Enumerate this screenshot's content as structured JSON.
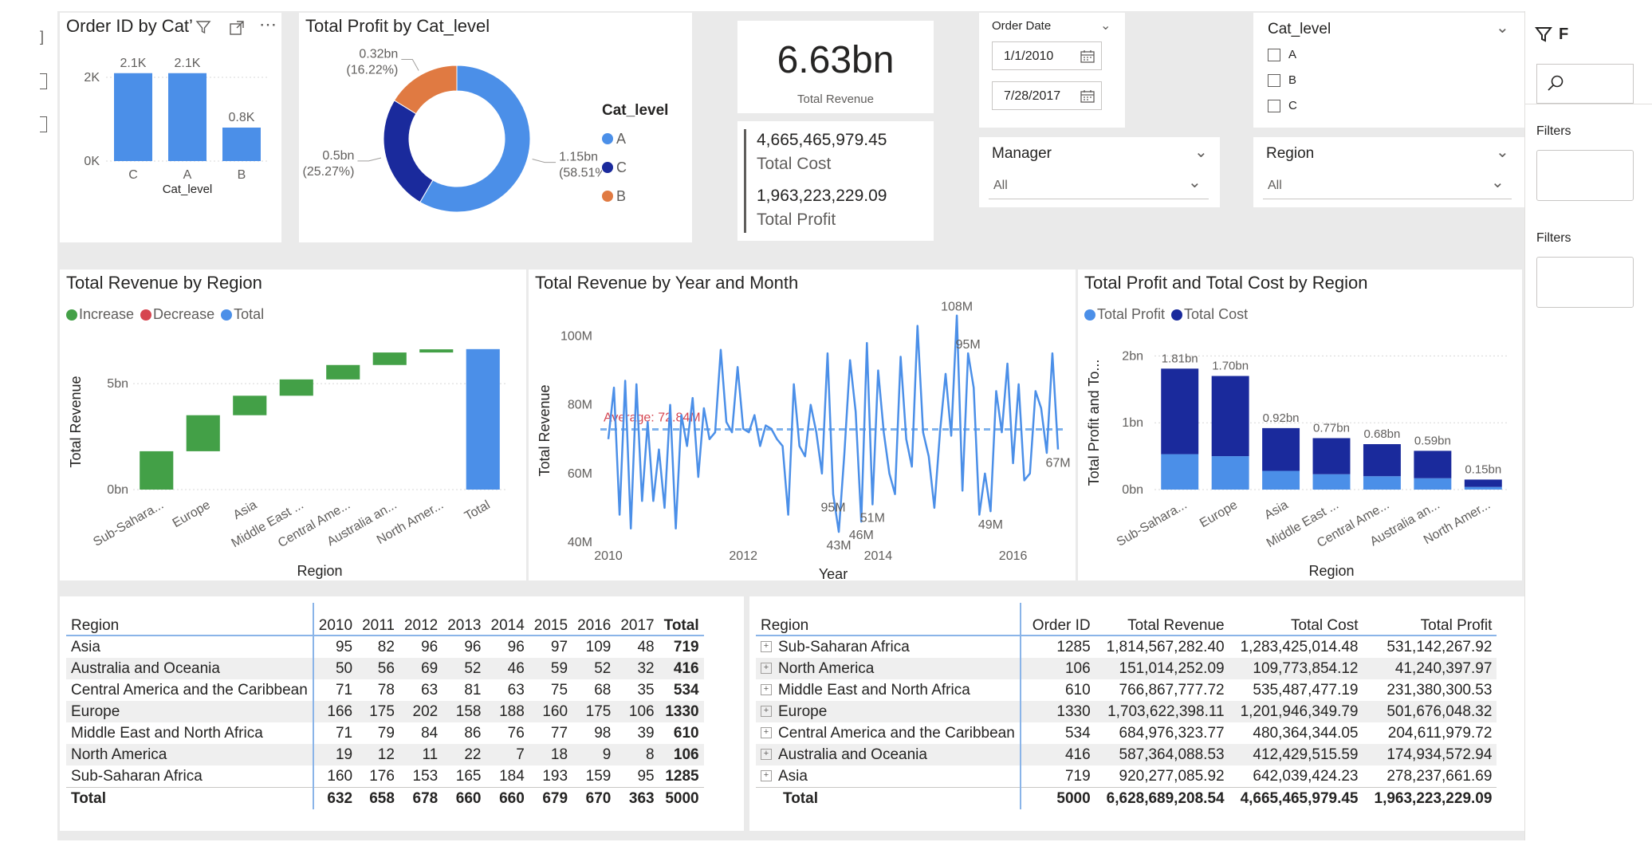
{
  "toolbar": {
    "menu_glyph": "⋯"
  },
  "filters_pane": {
    "label1": "Filters",
    "label2": "Filters",
    "header_letter": "F"
  },
  "order_chart": {
    "title": "Order ID by Cat",
    "title_suffix": "’",
    "chart_data": {
      "type": "bar",
      "categories": [
        "C",
        "A",
        "B"
      ],
      "values": [
        2100,
        2100,
        800
      ],
      "value_labels": [
        "2.1K",
        "2.1K",
        "0.8K"
      ],
      "ylim": [
        0,
        2400
      ],
      "yticks": [
        0,
        2000
      ],
      "ytick_labels": [
        "0K",
        "2K"
      ],
      "xlabel": "Cat_level",
      "color": "#4b8fe8"
    }
  },
  "profit_donut": {
    "title": "Total Profit by Cat_level",
    "legend_title": "Cat_level",
    "chart_data": {
      "type": "pie",
      "slices": [
        {
          "name": "A",
          "value": 1.15,
          "label1": "1.15bn",
          "label2": "(58.51%)",
          "color": "#4b8fe8"
        },
        {
          "name": "C",
          "value": 0.5,
          "label1": "0.5bn",
          "label2": "(25.27%)",
          "color": "#1a2a9c"
        },
        {
          "name": "B",
          "value": 0.32,
          "label1": "0.32bn",
          "label2": "(16.22%)",
          "color": "#e07a42"
        }
      ],
      "legend": [
        "A",
        "C",
        "B"
      ]
    }
  },
  "kpi": {
    "revenue_value": "6.63bn",
    "revenue_label": "Total Revenue",
    "cost_value": "4,665,465,979.45",
    "cost_label": "Total Cost",
    "profit_value": "1,963,223,229.09",
    "profit_label": "Total Profit"
  },
  "order_date": {
    "label": "Order Date",
    "start": "1/1/2010",
    "end": "7/28/2017"
  },
  "cat_slicer": {
    "label": "Cat_level",
    "options": [
      "A",
      "B",
      "C"
    ]
  },
  "manager": {
    "label": "Manager",
    "value": "All"
  },
  "region_slicer": {
    "label": "Region",
    "value": "All"
  },
  "revenue_waterfall": {
    "title": "Total Revenue by Region",
    "legend": [
      {
        "label": "Increase",
        "color": "#43a047"
      },
      {
        "label": "Decrease",
        "color": "#d64550"
      },
      {
        "label": "Total",
        "color": "#4b8fe8"
      }
    ],
    "chart_data": {
      "type": "bar",
      "subtype": "waterfall",
      "categories": [
        "Sub-Sahara...",
        "Europe",
        "Asia",
        "Middle East ...",
        "Central Ame...",
        "Australia an...",
        "North Amer...",
        "Total"
      ],
      "values": [
        1.81,
        1.7,
        0.92,
        0.77,
        0.68,
        0.59,
        0.15,
        6.63
      ],
      "ylim": [
        0,
        7
      ],
      "yticks": [
        0,
        5
      ],
      "ytick_labels": [
        "0bn",
        "5bn"
      ],
      "xlabel": "Region",
      "ylabel": "Total Revenue"
    }
  },
  "revenue_line": {
    "title": "Total Revenue by Year and Month",
    "average_label": "Average: 72.84M",
    "chart_data": {
      "type": "line",
      "values": [
        70,
        85,
        48,
        87,
        44,
        86,
        52,
        75,
        52,
        67,
        50,
        80,
        44,
        77,
        68,
        82,
        59,
        79,
        70,
        72,
        96,
        75,
        72,
        91,
        73,
        72,
        77,
        68,
        74,
        73,
        70,
        68,
        48,
        86,
        68,
        65,
        80,
        72,
        60,
        95,
        54,
        43,
        66,
        93,
        78,
        46,
        98,
        51,
        90,
        72,
        60,
        54,
        94,
        70,
        62,
        103,
        72,
        65,
        50,
        72,
        89,
        71,
        106,
        55,
        95,
        85,
        48,
        60,
        49,
        84,
        72,
        92,
        63,
        86,
        58,
        60,
        84,
        79,
        66,
        95,
        67
      ],
      "ylim": [
        40,
        105
      ],
      "yticks": [
        40,
        60,
        80,
        100
      ],
      "ytick_labels": [
        "40M",
        "60M",
        "80M",
        "100M"
      ],
      "xticks": [
        "2010",
        "2012",
        "2014",
        "2016"
      ],
      "average": 72.84,
      "point_labels": [
        {
          "index": 40,
          "text": "95M"
        },
        {
          "index": 41,
          "text": "43M"
        },
        {
          "index": 45,
          "text": "46M"
        },
        {
          "index": 47,
          "text": "51M"
        },
        {
          "index": 62,
          "text": "108M"
        },
        {
          "index": 64,
          "text": "95M"
        },
        {
          "index": 68,
          "text": "49M"
        },
        {
          "index": 80,
          "text": "67M"
        }
      ],
      "xlabel": "Year",
      "ylabel": "Total Revenue"
    }
  },
  "profit_cost": {
    "title": "Total Profit and Total Cost by Region",
    "legend": [
      {
        "label": "Total Profit",
        "color": "#4b8fe8"
      },
      {
        "label": "Total Cost",
        "color": "#1a2a9c"
      }
    ],
    "chart_data": {
      "type": "bar",
      "subtype": "stacked",
      "categories": [
        "Sub-Sahara...",
        "Europe",
        "Asia",
        "Middle East ...",
        "Central Ame...",
        "Australia an...",
        "North Amer..."
      ],
      "series": [
        {
          "name": "Total Profit",
          "values": [
            0.53,
            0.5,
            0.28,
            0.23,
            0.2,
            0.17,
            0.04
          ]
        },
        {
          "name": "Total Cost",
          "values": [
            1.28,
            1.2,
            0.64,
            0.54,
            0.48,
            0.41,
            0.11
          ]
        }
      ],
      "totals": [
        "1.81bn",
        "1.70bn",
        "0.92bn",
        "0.77bn",
        "0.68bn",
        "0.59bn",
        "0.15bn"
      ],
      "ylim": [
        0,
        2.1
      ],
      "yticks": [
        0,
        1,
        2
      ],
      "ytick_labels": [
        "0bn",
        "1bn",
        "2bn"
      ],
      "xlabel": "Region",
      "ylabel": "Total Profit and To..."
    }
  },
  "matrix_year": {
    "headers": [
      "Region",
      "2010",
      "2011",
      "2012",
      "2013",
      "2014",
      "2015",
      "2016",
      "2017",
      "Total"
    ],
    "rows": [
      [
        "Asia",
        "95",
        "82",
        "96",
        "96",
        "96",
        "97",
        "109",
        "48",
        "719"
      ],
      [
        "Australia and Oceania",
        "50",
        "56",
        "69",
        "52",
        "46",
        "59",
        "52",
        "32",
        "416"
      ],
      [
        "Central America and the Caribbean",
        "71",
        "78",
        "63",
        "81",
        "63",
        "75",
        "68",
        "35",
        "534"
      ],
      [
        "Europe",
        "166",
        "175",
        "202",
        "158",
        "188",
        "160",
        "175",
        "106",
        "1330"
      ],
      [
        "Middle East and North Africa",
        "71",
        "79",
        "84",
        "86",
        "76",
        "77",
        "98",
        "39",
        "610"
      ],
      [
        "North America",
        "19",
        "12",
        "11",
        "22",
        "7",
        "18",
        "9",
        "8",
        "106"
      ],
      [
        "Sub-Saharan Africa",
        "160",
        "176",
        "153",
        "165",
        "184",
        "193",
        "159",
        "95",
        "1285"
      ]
    ],
    "total": [
      "Total",
      "632",
      "658",
      "678",
      "660",
      "660",
      "679",
      "670",
      "363",
      "5000"
    ]
  },
  "matrix_region": {
    "headers": [
      "Region",
      "Order ID",
      "Total Revenue",
      "Total Cost",
      "Total Profit"
    ],
    "rows": [
      [
        "Sub-Saharan Africa",
        "1285",
        "1,814,567,282.40",
        "1,283,425,014.48",
        "531,142,267.92"
      ],
      [
        "North America",
        "106",
        "151,014,252.09",
        "109,773,854.12",
        "41,240,397.97"
      ],
      [
        "Middle East and North Africa",
        "610",
        "766,867,777.72",
        "535,487,477.19",
        "231,380,300.53"
      ],
      [
        "Europe",
        "1330",
        "1,703,622,398.11",
        "1,201,946,349.79",
        "501,676,048.32"
      ],
      [
        "Central America and the Caribbean",
        "534",
        "684,976,323.77",
        "480,364,344.05",
        "204,611,979.72"
      ],
      [
        "Australia and Oceania",
        "416",
        "587,364,088.53",
        "412,429,515.59",
        "174,934,572.94"
      ],
      [
        "Asia",
        "719",
        "920,277,085.92",
        "642,039,424.23",
        "278,237,661.69"
      ]
    ],
    "total": [
      "Total",
      "5000",
      "6,628,689,208.54",
      "4,665,465,979.45",
      "1,963,223,229.09"
    ]
  }
}
